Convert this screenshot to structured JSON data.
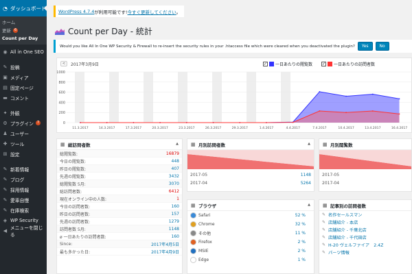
{
  "sidebar": {
    "dashboard": "ダッシュボード",
    "sub": [
      {
        "label": "ホーム"
      },
      {
        "label": "更新",
        "badge": "6"
      },
      {
        "label": "Count per Day"
      }
    ],
    "aioseo": "All in One SEO",
    "group1": [
      {
        "label": "投稿",
        "icon": "pin-icon"
      },
      {
        "label": "メディア",
        "icon": "media-icon"
      },
      {
        "label": "固定ページ",
        "icon": "page-icon"
      },
      {
        "label": "コメント",
        "icon": "comment-icon"
      }
    ],
    "group2": [
      {
        "label": "外観",
        "icon": "appearance-icon"
      },
      {
        "label": "プラグイン",
        "icon": "plugin-icon",
        "badge": "7"
      },
      {
        "label": "ユーザー",
        "icon": "user-icon"
      },
      {
        "label": "ツール",
        "icon": "tool-icon"
      },
      {
        "label": "設定",
        "icon": "settings-icon"
      }
    ],
    "group3": [
      {
        "label": "新着情報",
        "icon": "pin-icon"
      },
      {
        "label": "ブログ",
        "icon": "pin-icon"
      },
      {
        "label": "採用情報",
        "icon": "pin-icon"
      },
      {
        "label": "愛車自慢",
        "icon": "pin-icon"
      },
      {
        "label": "在庫検索",
        "icon": "pin-icon"
      },
      {
        "label": "WP Security",
        "icon": "shield-icon"
      },
      {
        "label": "メニューを閉じる",
        "icon": "collapse-icon"
      }
    ]
  },
  "notice_update": {
    "text1": "WordPress 4.7.4",
    "text2": " が利用可能です! ",
    "link": "今すぐ更新してください",
    "text3": "。"
  },
  "page_title": "Count per Day - 統計",
  "notice_security": {
    "text": "Would you like All In One WP Security & Firewall to re-insert the security rules in your .htaccess file which were cleared when you deactivated the plugin?",
    "yes": "Yes",
    "no": "No"
  },
  "chart": {
    "prev": "<",
    "date": "2017年3月9日",
    "legend_views": "一日あたりの閲覧数",
    "legend_visits": "一日あたりの訪問者数",
    "colors": {
      "views": "#3333ff",
      "visits": "#ff3333"
    }
  },
  "chart_data": {
    "type": "area",
    "x": [
      "11.3.2017",
      "14.3.2017",
      "17.3.2017",
      "20.3.2017",
      "23.3.2017",
      "26.3.2017",
      "29.3.2017",
      "1.4.2017",
      "4.4.2017",
      "7.4.2017",
      "10.4.2017",
      "13.4.2017",
      "16.4.2017"
    ],
    "ylim": [
      0,
      1000
    ],
    "yticks": [
      0,
      200,
      400,
      600,
      800,
      1000
    ],
    "series": [
      {
        "name": "一日あたりの閲覧数",
        "values": [
          0,
          0,
          0,
          0,
          0,
          0,
          0,
          0,
          10,
          610,
          520,
          560,
          470
        ]
      },
      {
        "name": "一日あたりの訪問者数",
        "values": [
          0,
          0,
          0,
          0,
          0,
          0,
          0,
          0,
          5,
          230,
          200,
          230,
          170
        ]
      }
    ]
  },
  "widget_total": {
    "title": "総訪問者数",
    "rows": [
      {
        "label": "総閲覧数:",
        "value": "16879",
        "red": true
      },
      {
        "label": "今日の閲覧数:",
        "value": "448"
      },
      {
        "label": "昨日の閲覧数:",
        "value": "407"
      },
      {
        "label": "先週の閲覧数:",
        "value": "3432"
      },
      {
        "label": "総閲覧数 5月:",
        "value": "3070"
      },
      {
        "label": "総訪問者数:",
        "value": "6412",
        "red": true
      },
      {
        "label": "現在オンライン中の人数:",
        "value": "1",
        "red": true
      },
      {
        "label": "今日の訪問者数:",
        "value": "160"
      },
      {
        "label": "昨日の訪問者数:",
        "value": "157"
      },
      {
        "label": "先週の訪問者数:",
        "value": "1279"
      },
      {
        "label": "訪問者数 5月:",
        "value": "1148"
      },
      {
        "label": "ø 一日あたりの訪問者数:",
        "value": "160"
      },
      {
        "label": "Since:",
        "value": "2017年4月5日"
      },
      {
        "label": "最も多かった日:",
        "value": "2017年4月9日"
      }
    ]
  },
  "widget_month_visitors": {
    "title": "月別訪問者数",
    "rows": [
      {
        "label": "2017-05",
        "value": "1148"
      },
      {
        "label": "2017-04",
        "value": "5264"
      }
    ]
  },
  "widget_month_views": {
    "title": "月別閲覧数",
    "rows": [
      {
        "label": "2017-05",
        "value": ""
      },
      {
        "label": "2017-04",
        "value": ""
      }
    ]
  },
  "widget_browsers": {
    "title": "ブラウザ",
    "rows": [
      {
        "name": "Safari",
        "pct": "52 %",
        "frac": 0.52,
        "color": "#3a8ad8"
      },
      {
        "name": "Chrome",
        "pct": "32 %",
        "frac": 0.32,
        "color": "#e0a020"
      },
      {
        "name": "その他",
        "pct": "11 %",
        "frac": 0.11,
        "color": "#888888"
      },
      {
        "name": "Firefox",
        "pct": "2 %",
        "frac": 0.02,
        "color": "#e06020"
      },
      {
        "name": "MSIE",
        "pct": "2 %",
        "frac": 0.02,
        "color": "#2070c0"
      },
      {
        "name": "Edge",
        "pct": "1 %",
        "frac": 0.01,
        "color": "#ffffff"
      }
    ]
  },
  "widget_articles": {
    "title": "記事別の訪問者数",
    "rows": [
      "名作セールスマン",
      "店舗紹介 - 本店",
      "店舗紹介 - 千葉北店",
      "店舗紹介 - 千代田店",
      "H-20 ヴェルファイア　2.4Z",
      "パーツ情報"
    ]
  }
}
